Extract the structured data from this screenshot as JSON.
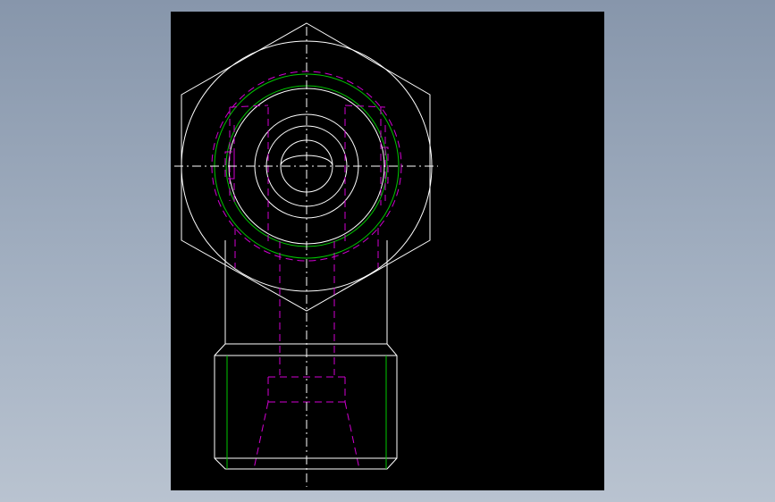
{
  "colors": {
    "page_background_top": "#8796ab",
    "page_background_bottom": "#b9c3d0",
    "viewport_background": "#000000",
    "outline_line": "#ffffff",
    "hidden_line": "#d200d2",
    "thread_line": "#00c800",
    "centerline": "#ffffff"
  },
  "drawing": {
    "description_visible_text": ""
  }
}
